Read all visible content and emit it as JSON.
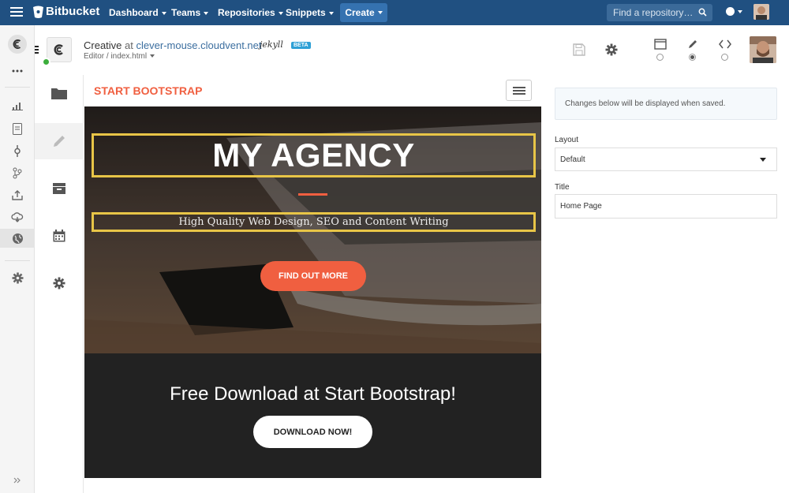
{
  "topnav": {
    "brand": "Bitbucket",
    "items": [
      {
        "label": "Dashboard"
      },
      {
        "label": "Teams"
      },
      {
        "label": "Repositories"
      },
      {
        "label": "Snippets"
      }
    ],
    "create_label": "Create",
    "search_placeholder": "Find a repository…"
  },
  "site": {
    "name": "Creative",
    "at": "at",
    "domain": "clever-mouse.cloudvent.net",
    "generator": "jekyll",
    "beta_badge": "BETA",
    "breadcrumb": "Editor / index.html"
  },
  "preview": {
    "brand": "START BOOTSTRAP",
    "hero_title": "MY AGENCY",
    "hero_subtitle": "High Quality Web Design, SEO and Content Writing",
    "hero_button": "FIND OUT MORE",
    "download_title": "Free Download at Start Bootstrap!",
    "download_button": "DOWNLOAD NOW!"
  },
  "panel": {
    "info": "Changes below will be displayed when saved.",
    "layout_label": "Layout",
    "layout_value": "Default",
    "title_label": "Title",
    "title_value": "Home Page"
  },
  "view_modes": {
    "selected": "edit"
  },
  "colors": {
    "nav_bg": "#205081",
    "create_bg": "#3572b0",
    "accent": "#f05f40",
    "highlight_border": "#e8c547",
    "status_green": "#3cae3c",
    "beta_bg": "#2ea0d6"
  },
  "icons": {
    "left_rail": [
      "cloudcannon-logo-icon",
      "more-icon",
      "stats-icon",
      "file-icon",
      "commit-icon",
      "branch-icon",
      "upload-icon",
      "cloud-deploy-icon",
      "globe-icon",
      "settings-icon",
      "expand-icon"
    ],
    "editor_sidebar": [
      "folder-icon",
      "pencil-icon",
      "inbox-icon",
      "calendar-icon",
      "gear-icon"
    ],
    "header": [
      "save-icon",
      "gear-icon",
      "desktop-view-icon",
      "edit-view-icon",
      "code-view-icon"
    ]
  }
}
